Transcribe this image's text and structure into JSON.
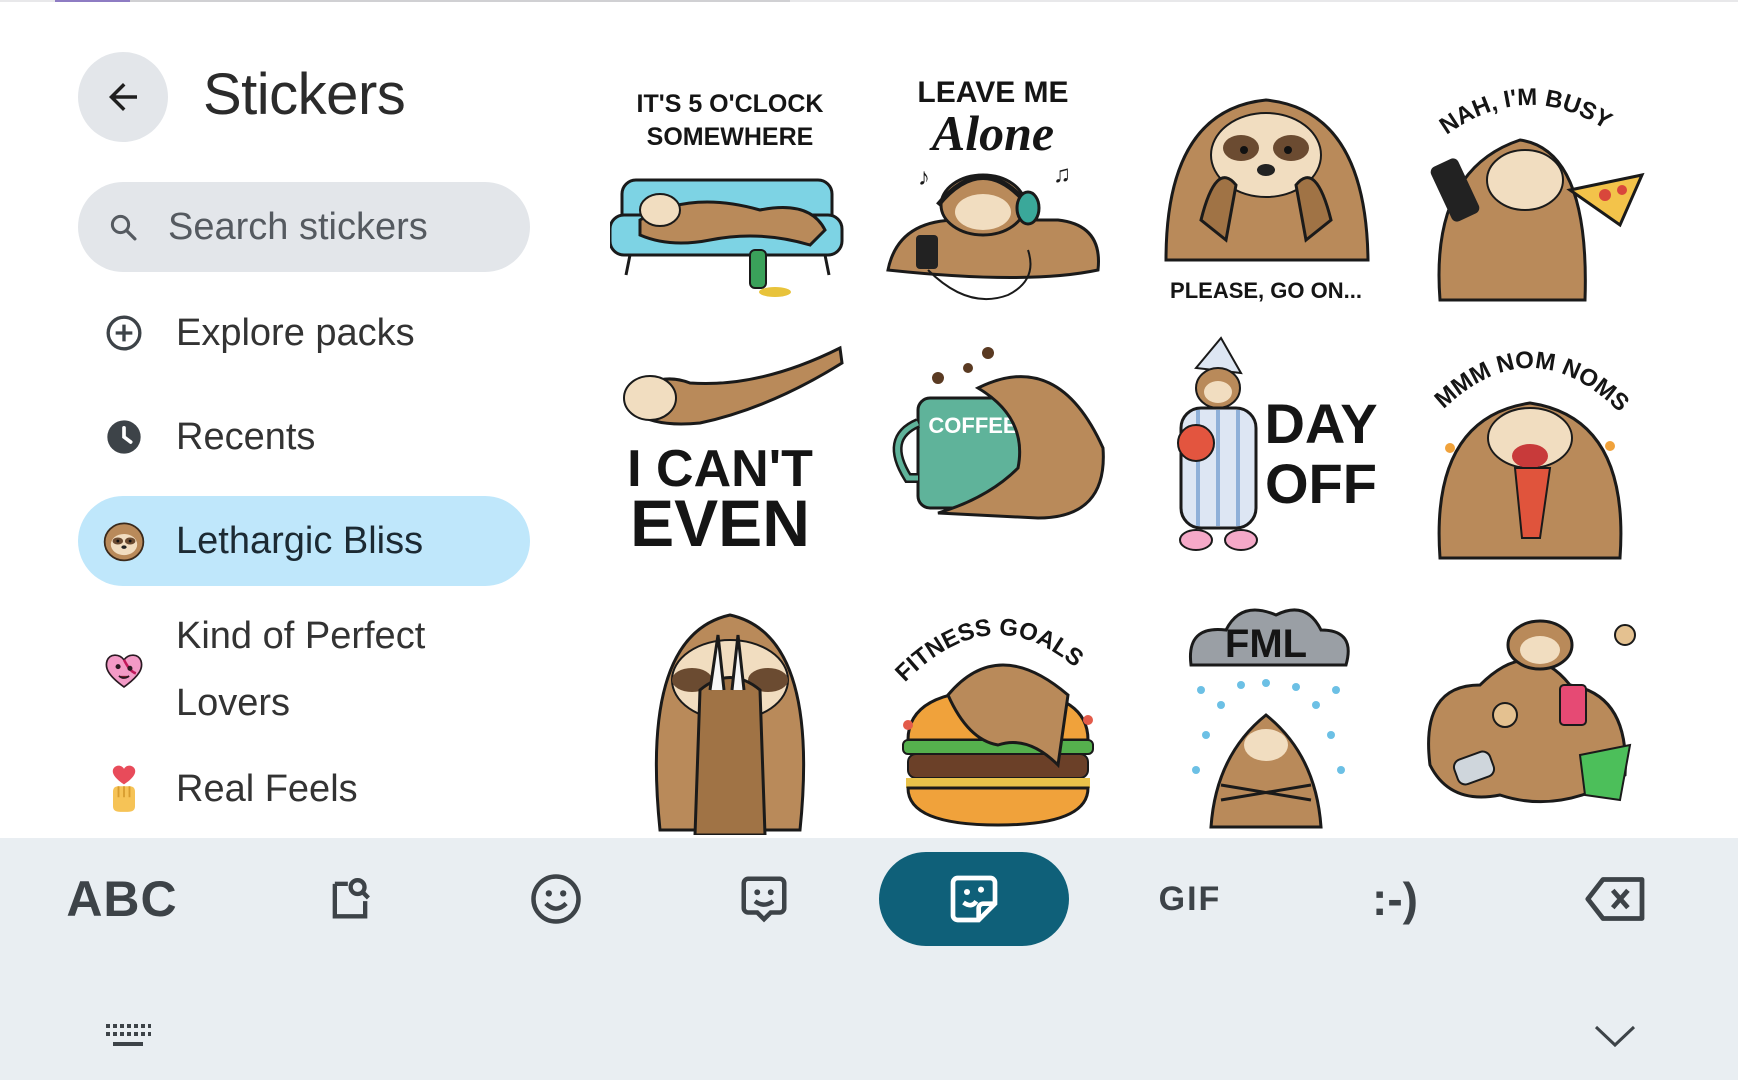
{
  "header": {
    "title": "Stickers",
    "back_icon": "back-arrow-icon"
  },
  "search": {
    "placeholder": "Search stickers",
    "icon": "search-icon"
  },
  "sidebar": {
    "items": [
      {
        "label": "Explore packs",
        "icon": "add-circle-icon",
        "active": false
      },
      {
        "label": "Recents",
        "icon": "clock-icon",
        "active": false
      },
      {
        "label": "Lethargic Bliss",
        "icon": "sloth-pack-icon",
        "active": true
      },
      {
        "label": "Kind of Perfect Lovers",
        "label_line1": "Kind of Perfect",
        "label_line2": "Lovers",
        "icon": "heart-pack-icon",
        "active": false
      },
      {
        "label": "Real Feels",
        "icon": "heart-hand-pack-icon",
        "active": false
      }
    ]
  },
  "stickers": [
    {
      "name": "sticker-5-oclock",
      "text": [
        "IT'S 5 O'CLOCK",
        "SOMEWHERE"
      ]
    },
    {
      "name": "sticker-leave-me-alone",
      "text": [
        "LEAVE ME",
        "Alone"
      ]
    },
    {
      "name": "sticker-please-go-on",
      "text": [
        "PLEASE, GO ON..."
      ]
    },
    {
      "name": "sticker-nah-im-busy",
      "text": [
        "NAH, I'M BUSY"
      ]
    },
    {
      "name": "sticker-i-cant-even",
      "text": [
        "I CAN'T",
        "EVEN"
      ]
    },
    {
      "name": "sticker-coffee",
      "text": [
        "COFFEE"
      ]
    },
    {
      "name": "sticker-day-off",
      "text": [
        "DAY",
        "OFF"
      ]
    },
    {
      "name": "sticker-mmm-nom-noms",
      "text": [
        "MMM NOM NOMS"
      ]
    },
    {
      "name": "sticker-facepalm",
      "text": []
    },
    {
      "name": "sticker-fitness-goals",
      "text": [
        "FITNESS GOALS"
      ]
    },
    {
      "name": "sticker-fml",
      "text": [
        "FML"
      ]
    },
    {
      "name": "sticker-snacks",
      "text": []
    }
  ],
  "toolbar": {
    "abc_label": "ABC",
    "gif_label": "GIF",
    "emoticon_label": ":-)",
    "selected": "stickers",
    "accent": "#0f6079"
  },
  "colors": {
    "active_item": "#bfe7fb",
    "sloth_fur": "#b98a5a",
    "keyboard_bg": "#e9eef2"
  }
}
